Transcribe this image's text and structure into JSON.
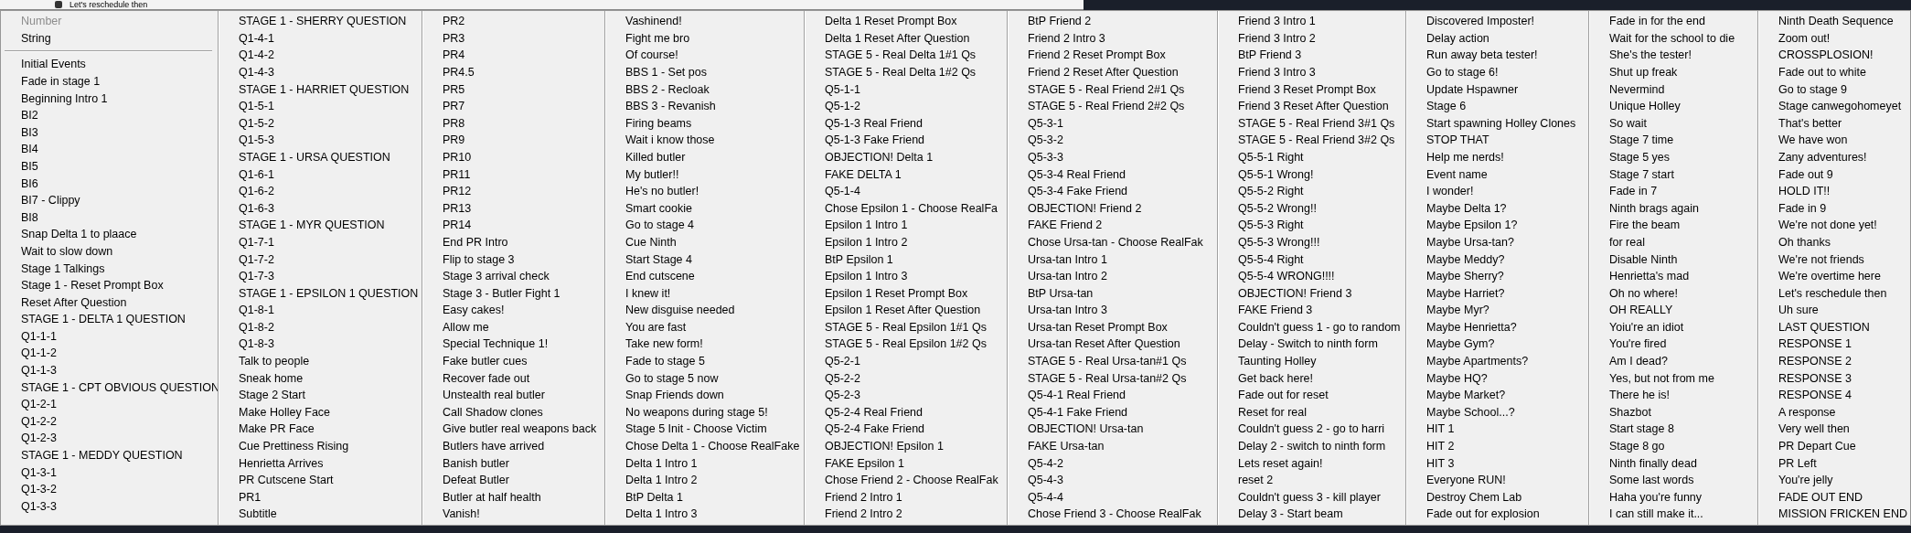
{
  "background_row": {
    "label": "Let's reschedule then"
  },
  "menu": {
    "header_items": [
      {
        "label": "Number",
        "disabled": true
      },
      {
        "label": "String",
        "disabled": false
      }
    ],
    "columns": [
      {
        "items": [
          "Initial Events",
          "Fade in stage 1",
          "Beginning Intro 1",
          "BI2",
          "BI3",
          "BI4",
          "BI5",
          "BI6",
          "BI7 - Clippy",
          "BI8",
          "Snap Delta 1 to plaace",
          "Wait to slow down",
          "Stage 1 Talkings",
          "Stage 1 - Reset Prompt Box",
          "Reset After Question",
          "STAGE 1 - DELTA 1 QUESTION",
          "Q1-1-1",
          "Q1-1-2",
          "Q1-1-3",
          "STAGE 1 - CPT OBVIOUS QUESTION",
          "Q1-2-1",
          "Q1-2-2",
          "Q1-2-3",
          "STAGE 1 - MEDDY QUESTION",
          "Q1-3-1",
          "Q1-3-2",
          "Q1-3-3"
        ]
      },
      {
        "items": [
          "STAGE 1 - SHERRY QUESTION",
          "Q1-4-1",
          "Q1-4-2",
          "Q1-4-3",
          "STAGE 1 - HARRIET QUESTION",
          "Q1-5-1",
          "Q1-5-2",
          "Q1-5-3",
          "STAGE 1 - URSA QUESTION",
          "Q1-6-1",
          "Q1-6-2",
          "Q1-6-3",
          "STAGE 1 - MYR QUESTION",
          "Q1-7-1",
          "Q1-7-2",
          "Q1-7-3",
          "STAGE 1 - EPSILON 1 QUESTION",
          "Q1-8-1",
          "Q1-8-2",
          "Q1-8-3",
          "Talk to people",
          "Sneak home",
          "Stage 2 Start",
          "Make Holley Face",
          "Make PR Face",
          "Cue Prettiness Rising",
          "Henrietta Arrives",
          "PR Cutscene Start",
          "PR1",
          "Subtitle"
        ]
      },
      {
        "items": [
          "PR2",
          "PR3",
          "PR4",
          "PR4.5",
          "PR5",
          "PR7",
          "PR8",
          "PR9",
          "PR10",
          "PR11",
          "PR12",
          "PR13",
          "PR14",
          "End PR Intro",
          "Flip to stage 3",
          "Stage 3 arrival check",
          "Stage 3 - Butler Fight 1",
          "Easy cakes!",
          "Allow me",
          "Special Technique 1!",
          "Fake butler cues",
          "Recover fade out",
          "Unstealth real butler",
          "Call Shadow clones",
          "Give butler real weapons back",
          "Butlers have arrived",
          "Banish butler",
          "Defeat Butler",
          "Butler at half health",
          "Vanish!"
        ]
      },
      {
        "items": [
          "Vashinend!",
          "Fight me bro",
          "Of course!",
          "BBS 1 - Set pos",
          "BBS 2 - Recloak",
          "BBS 3 - Revanish",
          "Firing beams",
          "Wait i know those",
          "Killed butler",
          "My butler!!",
          "He's no butler!",
          "Smart cookie",
          "Go to stage 4",
          "Cue Ninth",
          "Start Stage 4",
          "End cutscene",
          "I knew it!",
          "New disguise needed",
          "You are fast",
          "Take new form!",
          "Fade to stage 5",
          "Go to stage 5  now",
          "Snap Friends down",
          "No weapons during stage 5!",
          "Stage 5 Init - Choose Victim",
          "Chose Delta 1 - Choose RealFake",
          "Delta 1 Intro 1",
          "Delta 1 Intro 2",
          "BtP Delta 1",
          "Delta 1 Intro 3"
        ]
      },
      {
        "items": [
          "Delta 1 Reset Prompt Box",
          "Delta 1 Reset After Question",
          "STAGE 5 - Real Delta 1#1 Qs",
          "STAGE 5 - Real Delta 1#2 Qs",
          "Q5-1-1",
          "Q5-1-2",
          "Q5-1-3 Real Friend",
          "Q5-1-3 Fake Friend",
          "OBJECTION! Delta 1",
          "FAKE DELTA 1",
          "Q5-1-4",
          "Chose Epsilon 1 - Choose RealFa",
          "Epsilon 1 Intro 1",
          "Epsilon 1 Intro 2",
          "BtP Epsilon 1",
          "Epsilon 1 Intro 3",
          "Epsilon 1 Reset Prompt Box",
          "Epsilon 1 Reset After Question",
          "STAGE 5 - Real Epsilon 1#1 Qs",
          "STAGE 5 - Real Epsilon 1#2 Qs",
          "Q5-2-1",
          "Q5-2-2",
          "Q5-2-3",
          "Q5-2-4 Real Friend",
          "Q5-2-4 Fake Friend",
          "OBJECTION! Epsilon 1",
          "FAKE Epsilon 1",
          "Chose Friend 2 - Choose RealFak",
          "Friend 2 Intro 1",
          "Friend 2 Intro 2"
        ]
      },
      {
        "items": [
          "BtP Friend 2",
          "Friend 2 Intro 3",
          "Friend 2 Reset Prompt Box",
          "Friend 2 Reset After Question",
          "STAGE 5 - Real Friend 2#1 Qs",
          "STAGE 5 - Real Friend 2#2 Qs",
          "Q5-3-1",
          "Q5-3-2",
          "Q5-3-3",
          "Q5-3-4 Real Friend",
          "Q5-3-4 Fake Friend",
          "OBJECTION! Friend 2",
          "FAKE Friend 2",
          "Chose Ursa-tan - Choose RealFak",
          "Ursa-tan Intro 1",
          "Ursa-tan Intro 2",
          "BtP Ursa-tan",
          "Ursa-tan Intro 3",
          "Ursa-tan Reset Prompt Box",
          "Ursa-tan Reset After Question",
          "STAGE 5 - Real Ursa-tan#1 Qs",
          "STAGE 5 - Real Ursa-tan#2 Qs",
          "Q5-4-1 Real Friend",
          "Q5-4-1 Fake Friend",
          "OBJECTION! Ursa-tan",
          "FAKE Ursa-tan",
          "Q5-4-2",
          "Q5-4-3",
          "Q5-4-4",
          "Chose Friend 3 - Choose RealFak"
        ]
      },
      {
        "items": [
          "Friend 3 Intro 1",
          "Friend 3 Intro 2",
          "BtP Friend 3",
          "Friend 3 Intro 3",
          "Friend 3 Reset Prompt Box",
          "Friend 3 Reset After Question",
          "STAGE 5 - Real Friend 3#1 Qs",
          "STAGE 5 - Real Friend 3#2 Qs",
          "Q5-5-1 Right",
          "Q5-5-1 Wrong!",
          "Q5-5-2 Right",
          "Q5-5-2 Wrong!!",
          "Q5-5-3 Right",
          "Q5-5-3 Wrong!!!",
          "Q5-5-4 Right",
          "Q5-5-4 WRONG!!!!",
          "OBJECTION! Friend 3",
          "FAKE Friend 3",
          "Couldn't guess 1 - go to random",
          "Delay - Switch to ninth form",
          "Taunting Holley",
          "Get back here!",
          "Fade out for reset",
          "Reset for real",
          "Couldn't guess 2 - go to harri",
          "Delay 2 - switch to ninth form",
          "Lets reset again!",
          "reset 2",
          "Couldn't guess 3 - kill player",
          "Delay 3 - Start beam"
        ]
      },
      {
        "items": [
          "Discovered Imposter!",
          "Delay action",
          "Run away beta tester!",
          "Go to stage 6!",
          "Update Hspawner",
          "Stage 6",
          "Start spawning Holley Clones",
          "STOP THAT",
          "Help me nerds!",
          "Event name",
          "I wonder!",
          "Maybe Delta 1?",
          "Maybe Epsilon 1?",
          "Maybe Ursa-tan?",
          "Maybe Meddy?",
          "Maybe Sherry?",
          "Maybe Harriet?",
          "Maybe Myr?",
          "Maybe Henrietta?",
          "Maybe Gym?",
          "Maybe Apartments?",
          "Maybe HQ?",
          "Maybe Market?",
          "Maybe School...?",
          "HIT 1",
          "HIT 2",
          "HIT 3",
          "Everyone RUN!",
          "Destroy Chem Lab",
          "Fade out for explosion"
        ]
      },
      {
        "items": [
          "Fade in for the end",
          "Wait for the school to die",
          "She's the tester!",
          "Shut up freak",
          "Nevermind",
          "Unique Holley",
          "So wait",
          "Stage 7 time",
          "Stage 5 yes",
          "Stage 7 start",
          "Fade in 7",
          "Ninth brags again",
          "Fire the beam",
          "for real",
          "Disable Ninth",
          "Henrietta's mad",
          "Oh no where!",
          "OH REALLY",
          "Yoiu're an idiot",
          "You're fired",
          "Am I dead?",
          "Yes, but not from me",
          "There he is!",
          "Shazbot",
          "Start stage 8",
          "Stage 8 go",
          "Ninth finally dead",
          "Some last words",
          "Haha you're funny",
          "I can still make it..."
        ]
      },
      {
        "items": [
          "Ninth Death Sequence",
          "Zoom out!",
          "CROSSPLOSION!",
          "Fade out to white",
          "Go to stage 9",
          "Stage canwegohomeyet",
          "That's better",
          "We have won",
          "Zany adventures!",
          "Fade out 9",
          "HOLD IT!!",
          "Fade in 9",
          "We're not done yet!",
          "Oh thanks",
          "We're not friends",
          "We're overtime here",
          "Let's reschedule then",
          "Uh sure",
          "LAST QUESTION",
          "RESPONSE 1",
          "RESPONSE 2",
          "RESPONSE 3",
          "RESPONSE 4",
          "A response",
          "Very well then",
          "PR Depart Cue",
          "PR Left",
          "You're jelly",
          "FADE OUT END",
          "MISSION FRICKEN END"
        ]
      }
    ]
  }
}
